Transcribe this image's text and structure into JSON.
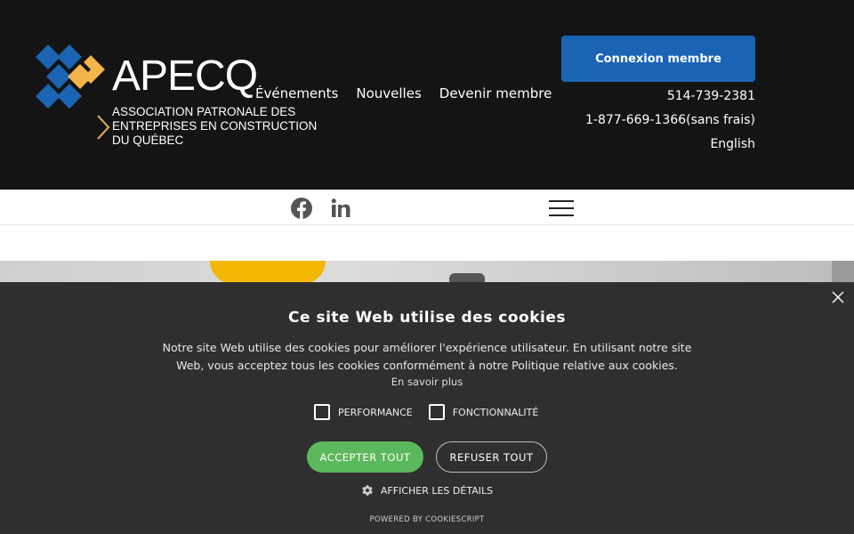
{
  "brand": {
    "name": "APECQ",
    "subtitle_lines": [
      "ASSOCIATION PATRONALE DES",
      "ENTREPRISES EN CONSTRUCTION",
      "DU QUÉBEC"
    ],
    "colors": {
      "blue": "#1b64b4",
      "orange": "#f3b44a",
      "dark": "#141415"
    }
  },
  "nav": {
    "items": [
      {
        "label": "Événements"
      },
      {
        "label": "Nouvelles"
      },
      {
        "label": "Devenir membre"
      }
    ]
  },
  "header": {
    "login_label": "Connexion membre",
    "phone_local": "514-739-2381",
    "phone_tollfree": "1-877-669-1366(sans frais)",
    "language": "English"
  },
  "social": {
    "icons": [
      "facebook-icon",
      "linkedin-icon"
    ]
  },
  "cookie": {
    "title": "Ce site Web utilise des cookies",
    "text": "Notre site Web utilise des cookies pour améliorer l'expérience utilisateur. En utilisant notre site Web, vous acceptez tous les cookies conformément à notre Politique relative aux cookies.",
    "more_label": "En savoir plus",
    "options": [
      {
        "label": "PERFORMANCE",
        "checked": false
      },
      {
        "label": "FONCTIONNALITÉ",
        "checked": false
      }
    ],
    "accept_label": "ACCEPTER TOUT",
    "refuse_label": "REFUSER TOUT",
    "details_label": "AFFICHER LES DÉTAILS",
    "powered_label": "POWERED BY COOKIESCRIPT",
    "colors": {
      "background": "#2f2f2f",
      "accept": "#5cb85c"
    }
  }
}
